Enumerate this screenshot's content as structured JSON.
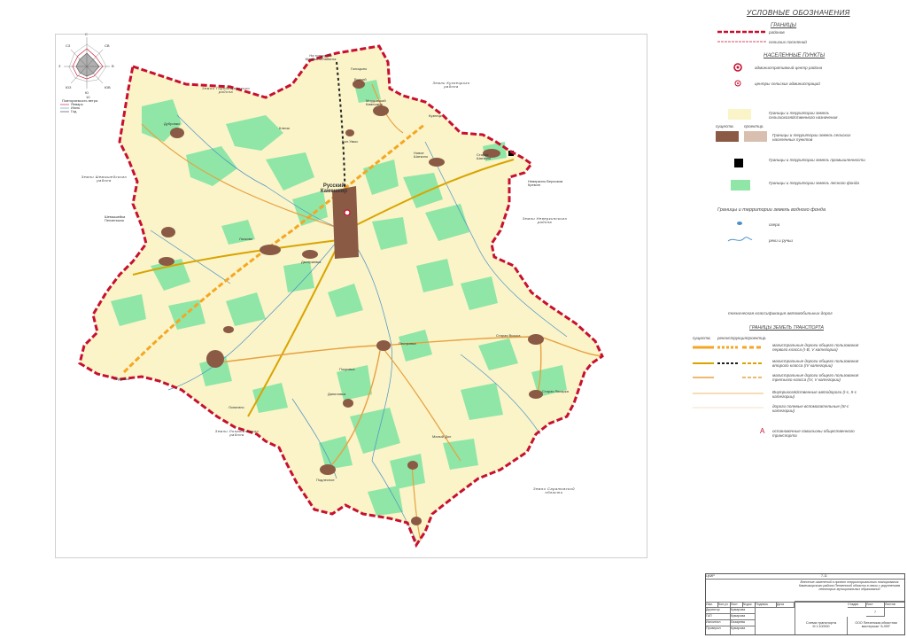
{
  "legend": {
    "title": "УСЛОВНЫЕ ОБОЗНАЧЕНИЯ",
    "boundaries_header": "ГРАНИЦЫ",
    "boundary_district": "районов",
    "boundary_rural": "сельских поселений",
    "settlements_header": "НАСЕЛЕННЫЕ ПУНКТЫ",
    "admin_center": "административный центр района",
    "rural_admin_center": "центры сельских администраций",
    "agri_lands": "Границы и территории земель сельскохозяйственного назначения",
    "existing_label": "существ.",
    "project_label": "проектир.",
    "settlement_lands": "Границы и территории земель сельских населенных пунктов",
    "industry_lands": "Границы и территории земель промышленности",
    "forest_lands": "Границы и территории земель лесного фонда",
    "water_header": "Границы и территории земель водного фонда",
    "lakes": "озера",
    "rivers": "реки и ручьи",
    "road_class_header": "техническая классификация автомобильных дорог",
    "transport_header": "ГРАНИЦЫ ЗЕМЕЛЬ ТРАНСПОРТА",
    "reconstruction_label": "реконструкция",
    "road_1": "магистральные дороги общего пользования первого класса (I-В, V категории)",
    "road_2": "магистральные дороги общего пользования второго класса (IV категории)",
    "road_3": "магистральные дороги общего пользования третьего класса (IV, V категории)",
    "road_4": "Внутрихозяйственные автодороги (I-с, II-с категории)",
    "road_5": "дороги полевые вспомогательные (III-с категории)",
    "bus_stop_symbol": "А",
    "bus_stop": "остановочные павильоны общественного транспорта"
  },
  "wind_rose": {
    "title": "Повторяемость ветра",
    "directions": [
      "С",
      "СВ",
      "В",
      "ЮВ",
      "Ю",
      "ЮЗ",
      "З",
      "СЗ"
    ],
    "scale": "10",
    "legend": [
      "Январь",
      "Июль",
      "Год"
    ]
  },
  "map": {
    "district_center": "Русский Камешкир",
    "lands": [
      "Земли Городищенского района",
      "Земли Кузнецкого района",
      "Земли Шемышейского района",
      "Земли Неверкинского района",
      "Земли Лопатинского района",
      "Земли Саратовской области"
    ],
    "places": [
      "Голицыно",
      "Волчий",
      "Мордовский Камешкир",
      "Кузнецк",
      "Бол.Умыс",
      "Ключи",
      "Дубровки",
      "Новое Шаткино",
      "Старое Шаткино",
      "Лачкове",
      "Дмитриевка",
      "Шемышейка Пензенская",
      "Старая Вышка",
      "Старая Яксарка",
      "Пестровка",
      "Покровка",
      "Даниловка",
      "Малый Дол",
      "Подлесное",
      "Лопатино",
      "Сердобск",
      "Неверкино Верхозим Кремлн"
    ],
    "road_labels": [
      "На трассу М5 Москва-Челябинск",
      "Кузнецк",
      "Сердобск",
      "Лопатино",
      "Неверкино на Верхозим Кремлн"
    ]
  },
  "stamp": {
    "code": "ЦКИР",
    "sheet_code": "7-11",
    "project_title": "Внесение изменений в проект территориального планирования Камешкирского района Пензенской области в связи с укрупнением некоторых муниципальных образований",
    "rows": [
      {
        "role": "Изм.",
        "name": "Кол.уч."
      },
      {
        "role": "Директор",
        "name": "Кумарова"
      },
      {
        "role": "ГАП",
        "name": "Кумарова"
      },
      {
        "role": "Исполнил",
        "name": "Лазарева"
      },
      {
        "role": "Проверил",
        "name": "Кумарова"
      }
    ],
    "header_cols": [
      "Изм.",
      "Кол.уч",
      "Лист",
      "№док",
      "Подпись",
      "Дата"
    ],
    "stage_label": "Стадия",
    "sheet_label": "Лист",
    "sheets_label": "Листов",
    "sheet_number": "7",
    "drawing_title": "Схема транспорта",
    "scale": "М 1:100000",
    "org": "ООО Пензенская областная мастерская \"А-999\""
  },
  "colors": {
    "agri": "#faf4c8",
    "forest": "#8fe6a6",
    "settlement": "#8a5a44",
    "boundary": "#c8102e",
    "road_orange": "#f5a623",
    "road_gold": "#d9a400",
    "water": "#4a90c8"
  }
}
